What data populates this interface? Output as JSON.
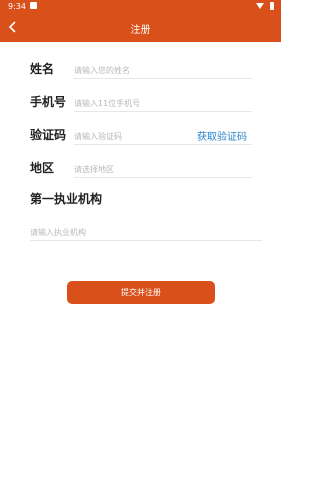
{
  "status_bar": {
    "time": "9:34"
  },
  "header": {
    "title": "注册"
  },
  "form": {
    "name": {
      "label": "姓名",
      "placeholder": "请输入您的姓名"
    },
    "phone": {
      "label": "手机号",
      "placeholder": "请输入11位手机号"
    },
    "code": {
      "label": "验证码",
      "placeholder": "请输入验证码",
      "get_code_label": "获取验证码"
    },
    "region": {
      "label": "地区",
      "placeholder": "请选择地区"
    },
    "institution": {
      "label": "第一执业机构",
      "placeholder": "请输入执业机构"
    }
  },
  "submit_label": "提交并注册",
  "colors": {
    "brand": "#d9501b",
    "link": "#2a82c8"
  }
}
